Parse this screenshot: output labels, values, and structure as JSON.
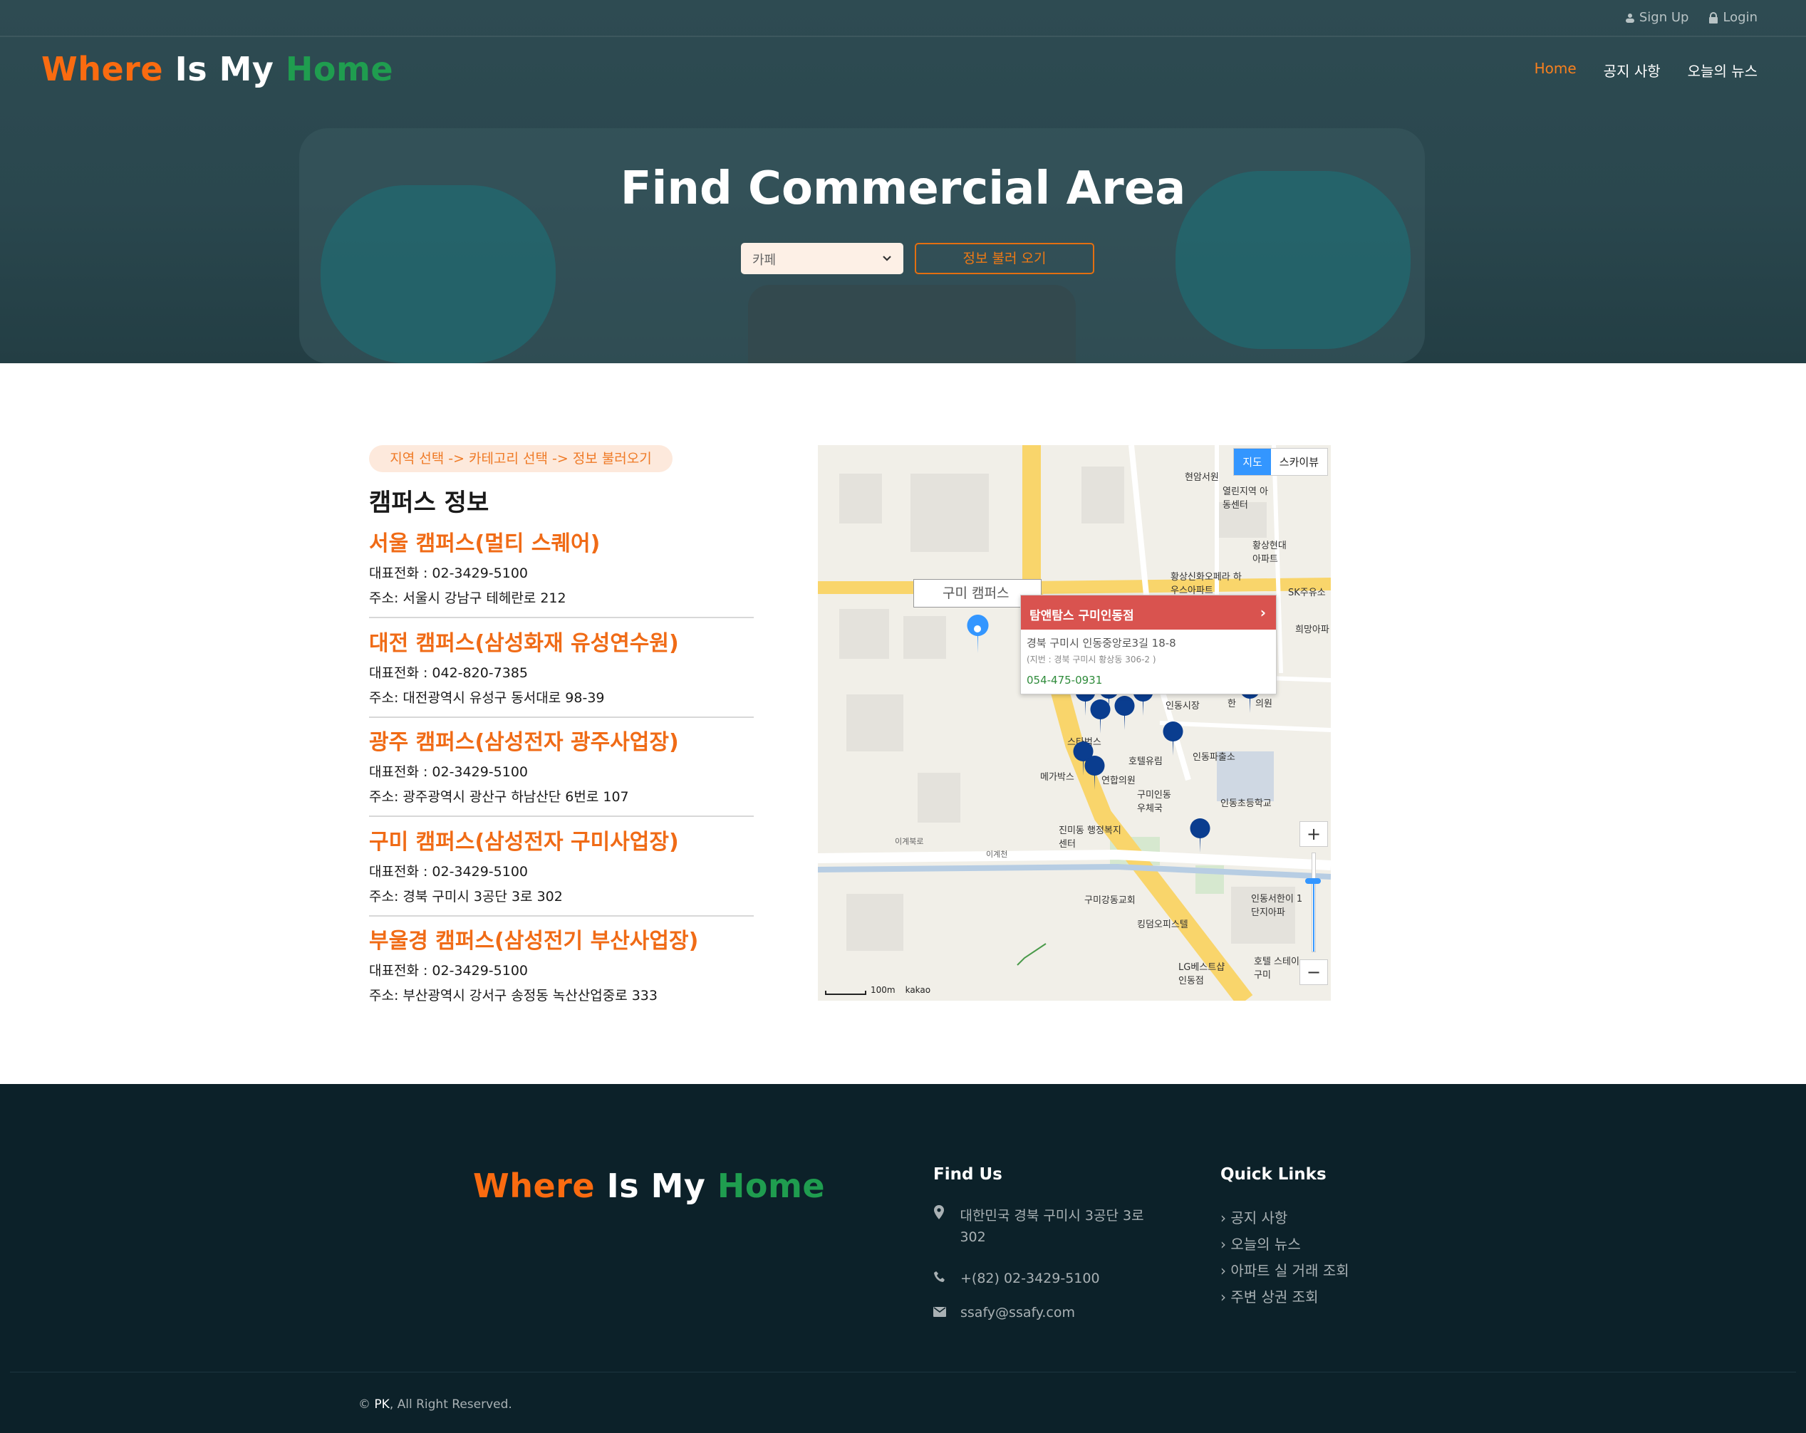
{
  "topbar": {
    "signup": "Sign Up",
    "login": "Login"
  },
  "brand": {
    "word1": "Where",
    "word2": "Is My",
    "word3": "Home"
  },
  "nav": [
    "Home",
    "공지 사항",
    "오늘의 뉴스"
  ],
  "hero": {
    "title": "Find Commercial Area",
    "select_value": "카페",
    "button": "정보 불러 오기"
  },
  "hint": "지역 선택 -> 카테고리 선택 -> 정보 불러오기",
  "campus_title": "캠퍼스 정보",
  "campuses": [
    {
      "name": "서울 캠퍼스(멀티 스퀘어)",
      "phone": "대표전화 : 02-3429-5100",
      "address": "주소: 서울시 강남구 테헤란로 212"
    },
    {
      "name": "대전 캠퍼스(삼성화재 유성연수원)",
      "phone": "대표전화 : 042-820-7385",
      "address": "주소: 대전광역시 유성구 동서대로 98-39"
    },
    {
      "name": "광주 캠퍼스(삼성전자 광주사업장)",
      "phone": "대표전화 : 02-3429-5100",
      "address": "주소: 광주광역시 광산구 하남산단 6번로 107"
    },
    {
      "name": "구미 캠퍼스(삼성전자 구미사업장)",
      "phone": "대표전화 : 02-3429-5100",
      "address": "주소: 경북 구미시 3공단 3로 302"
    },
    {
      "name": "부울경 캠퍼스(삼성전기 부산사업장)",
      "phone": "대표전화 : 02-3429-5100",
      "address": "주소: 부산광역시 강서구 송정동 녹산산업중로 333"
    }
  ],
  "map": {
    "toggle_map": "지도",
    "toggle_sky": "스카이뷰",
    "label": "구미 캠퍼스",
    "info_title": "탐앤탐스 구미인동점",
    "info_address": "경북 구미시 인동중앙로3길 18-8",
    "info_jibun": "(지번 : 경북 구미시 황상동 306-2 )",
    "info_tel": "054-475-0931",
    "zoom_in": "+",
    "zoom_out": "−",
    "scale": "100m",
    "attribution": "kakao",
    "labels": [
      "현암서원",
      "열린지역 아동센터",
      "황상현대 아파트",
      "황상신화오페라 하우스아파트",
      "SK주유소",
      "희망아파",
      "인동시장",
      "한",
      "의원",
      "스타벅스",
      "호텔유림",
      "인동파출소",
      "메가박스",
      "연합의원",
      "구미인동 우체국",
      "인동초등학교",
      "진미동 행정복지센터",
      "이계북로",
      "이계천",
      "구미강동교회",
      "킹덤오피스텔",
      "인동서한이 1단지아파",
      "LG베스트샵 인동점",
      "호텔 스테이구미"
    ]
  },
  "footer": {
    "find_us": "Find Us",
    "address": "대한민국 경북 구미시 3공단 3로 302",
    "phone": "+(82) 02-3429-5100",
    "email": "ssafy@ssafy.com",
    "quick_links": "Quick Links",
    "links": [
      "공지 사항",
      "오늘의 뉴스",
      "아파트 실 거래 조회",
      "주변 상권 조회"
    ],
    "copyright_mark": "©",
    "copyright_owner": "PK",
    "copyright_rest": ", All Right Reserved."
  },
  "colors": {
    "accent_orange": "#f06b16",
    "brand_green": "#1f9d4f",
    "footer_bg": "#0c2129",
    "hero_bg": "#2e4b52",
    "map_info_red": "#d9534f"
  }
}
